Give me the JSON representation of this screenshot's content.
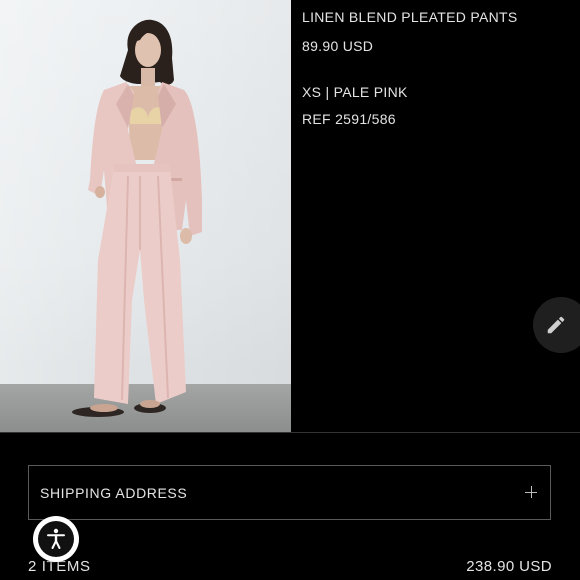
{
  "product": {
    "name": "LINEN BLEND PLEATED PANTS",
    "price": "89.90 USD",
    "variant": "XS | PALE PINK",
    "reference": "REF 2591/586",
    "image_icon": "product-photo"
  },
  "actions": {
    "edit_icon": "pencil-icon",
    "accessibility_icon": "accessibility-person-icon"
  },
  "shipping": {
    "label": "SHIPPING ADDRESS",
    "expand_icon": "plus-icon"
  },
  "summary": {
    "items_count": "2 ITEMS",
    "total": "238.90 USD"
  },
  "colors": {
    "background": "#000000",
    "text": "#e4e4e4",
    "border": "#5a5a5a",
    "garment": "#e9c9c6"
  }
}
